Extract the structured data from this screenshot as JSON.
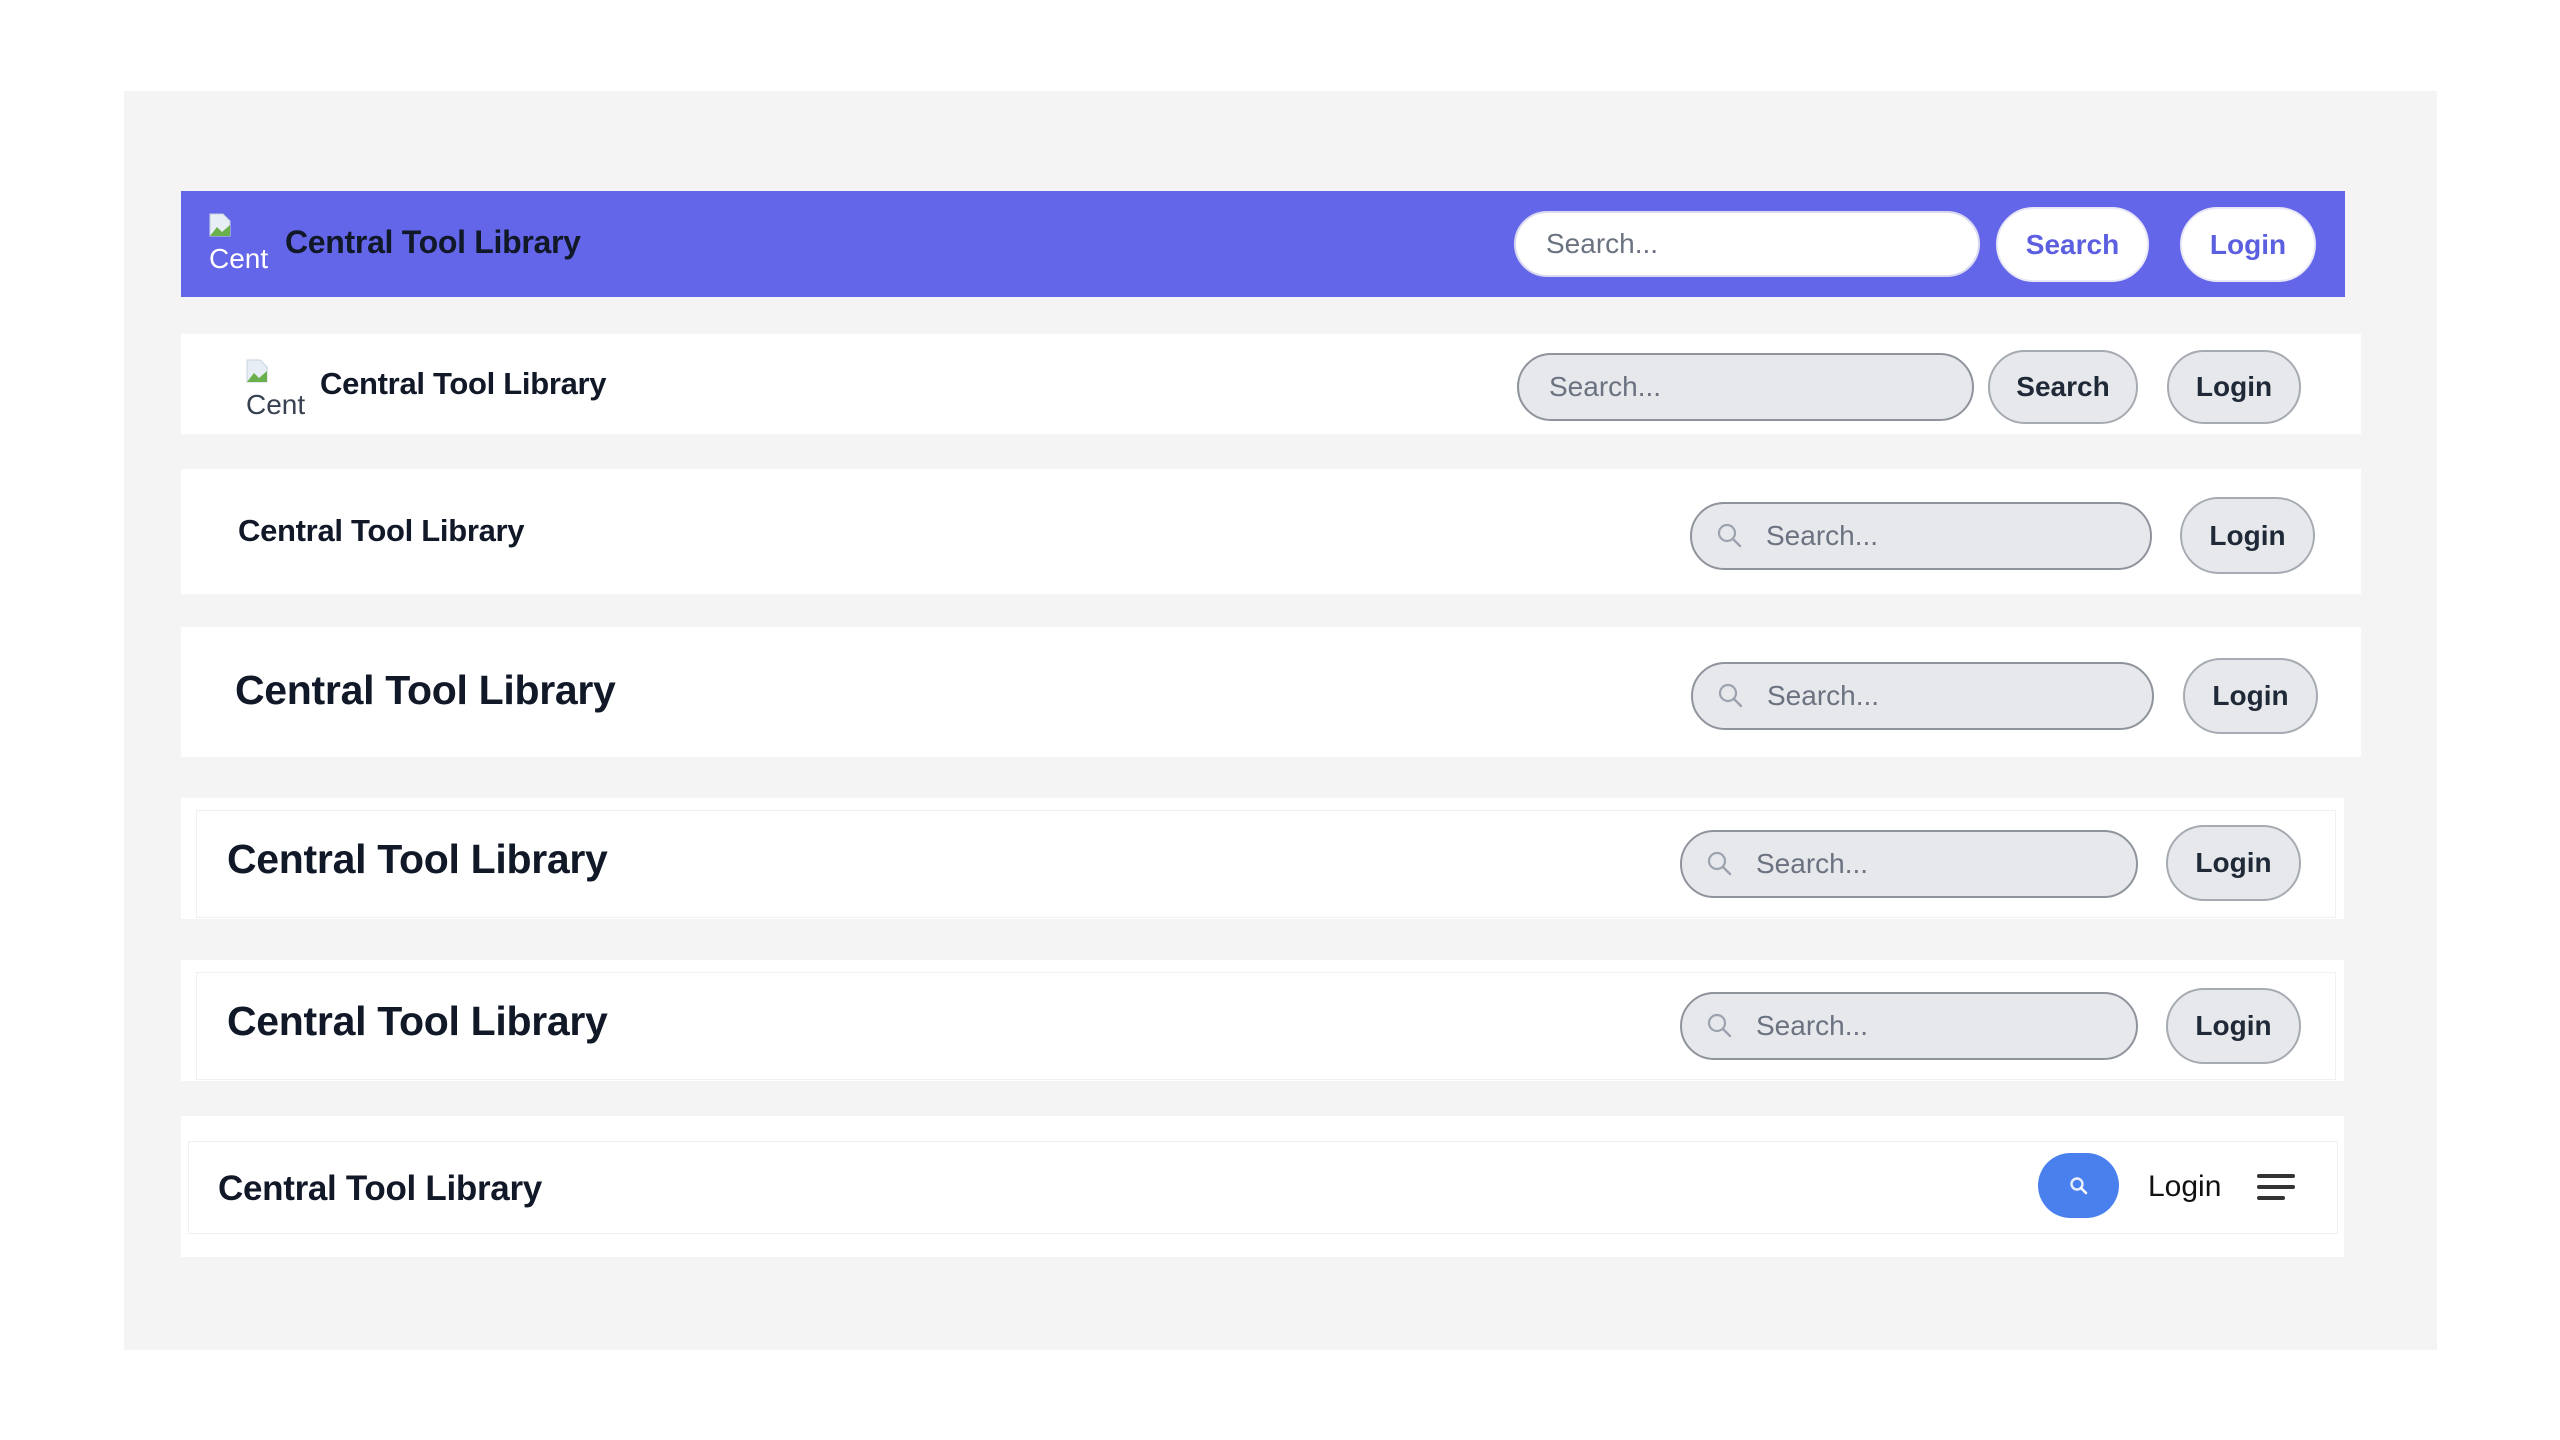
{
  "app_title": "Central Tool Library",
  "colors": {
    "panel_bg": "#f4f4f4",
    "primary_bar": "#6366e8",
    "primary_text": "#5b5fe0",
    "mobile_search_button": "#4a80ee"
  },
  "variants": [
    {
      "style": "primary-bar",
      "logo_alt": "Cent",
      "title": "Central Tool Library",
      "search_placeholder": "Search...",
      "search_button_label": "Search",
      "login_label": "Login"
    },
    {
      "style": "white-with-logo",
      "logo_alt": "Cent",
      "title": "Central Tool Library",
      "search_placeholder": "Search...",
      "search_button_label": "Search",
      "login_label": "Login"
    },
    {
      "style": "white-search-icon-small",
      "title": "Central Tool Library",
      "search_icon": "search-icon",
      "search_placeholder": "Search...",
      "login_label": "Login"
    },
    {
      "style": "white-search-icon-large",
      "title": "Central Tool Library",
      "search_icon": "search-icon",
      "search_placeholder": "Search...",
      "login_label": "Login"
    },
    {
      "style": "white-search-icon-large",
      "title": "Central Tool Library",
      "search_icon": "search-icon",
      "search_placeholder": "Search...",
      "login_label": "Login"
    },
    {
      "style": "white-search-icon-large",
      "title": "Central Tool Library",
      "search_icon": "search-icon",
      "search_placeholder": "Search...",
      "login_label": "Login"
    },
    {
      "style": "compact-mobile",
      "title": "Central Tool Library",
      "search_icon": "search-icon",
      "login_label": "Login",
      "menu_icon": "hamburger-menu-icon"
    }
  ]
}
